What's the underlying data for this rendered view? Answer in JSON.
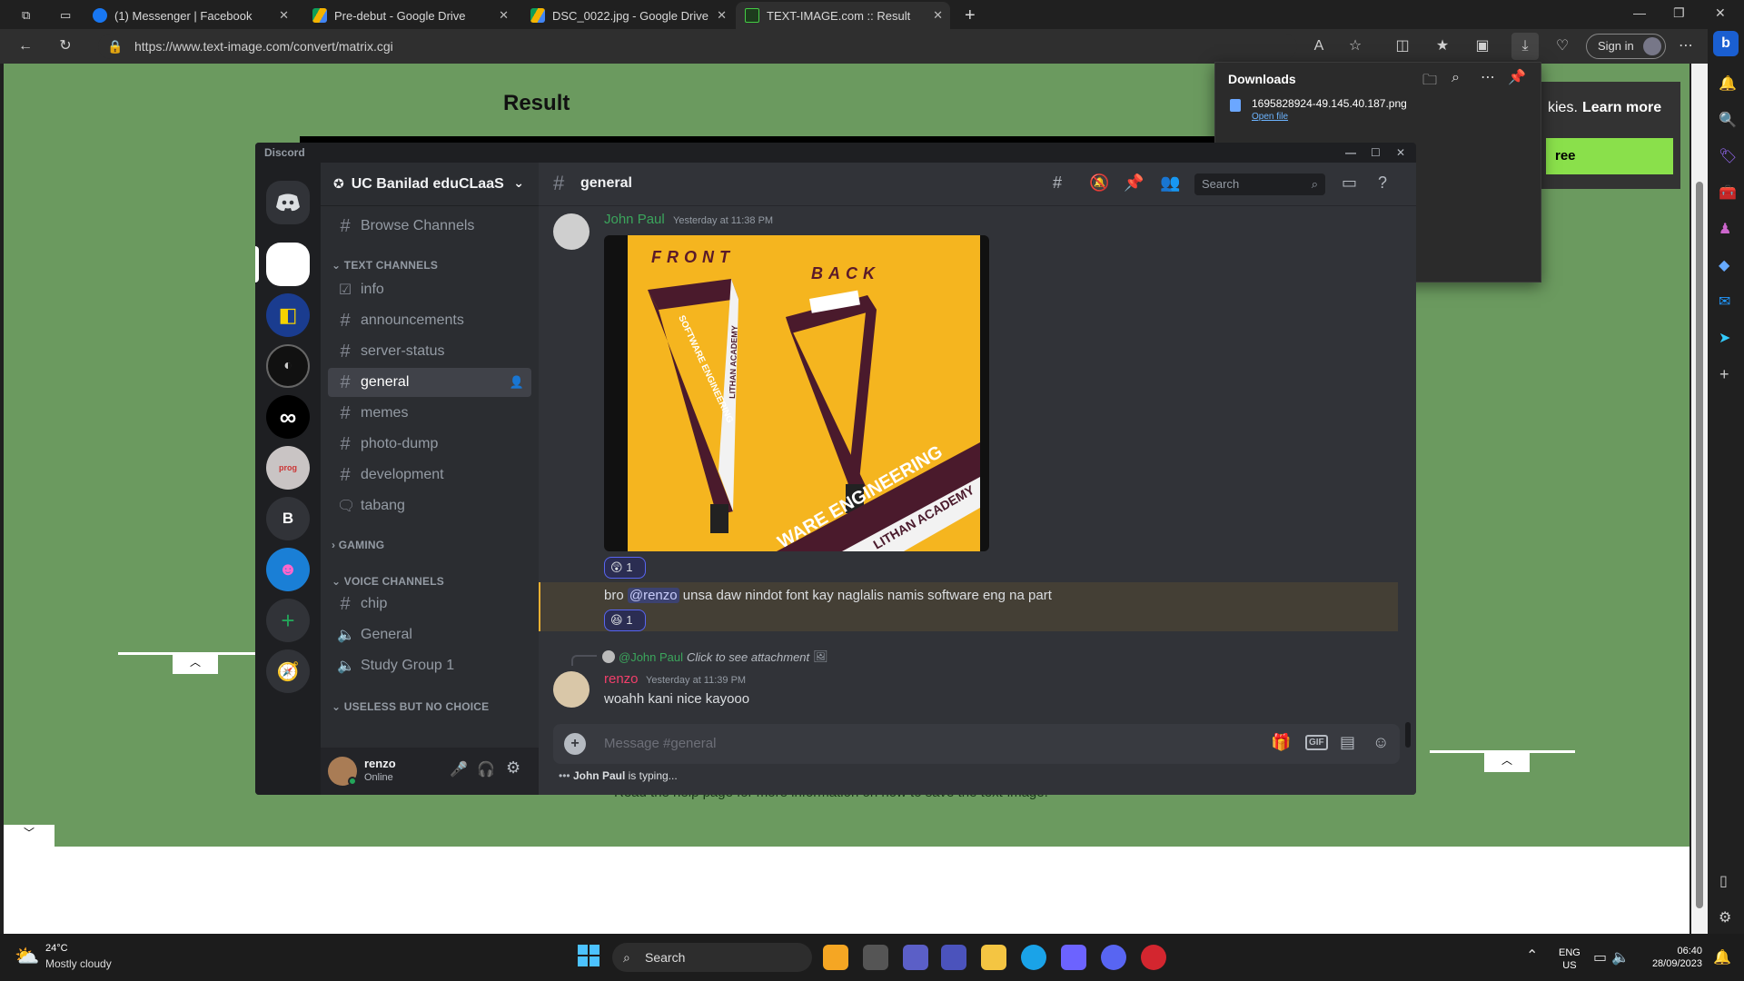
{
  "browser": {
    "tabs": [
      {
        "label": "(1) Messenger | Facebook"
      },
      {
        "label": "Pre-debut - Google Drive"
      },
      {
        "label": "DSC_0022.jpg - Google Drive"
      },
      {
        "label": "TEXT-IMAGE.com :: Result"
      }
    ],
    "url": "https://www.text-image.com/convert/matrix.cgi",
    "sign_in": "Sign in"
  },
  "page": {
    "heading": "Result",
    "cookies_text": "kies.",
    "learn_more": "Learn more",
    "green_button": "ree",
    "footer_text": "Read the help page for more information on how to save the text-image."
  },
  "downloads": {
    "title": "Downloads",
    "file_name": "1695828924-49.145.40.187.png",
    "open_file": "Open file"
  },
  "discord": {
    "app_title": "Discord",
    "server_name": "UC Banilad eduCLaaS",
    "browse_channels": "Browse Channels",
    "categories": {
      "text": "TEXT CHANNELS",
      "gaming": "GAMING",
      "voice": "VOICE CHANNELS",
      "useless": "USELESS BUT NO CHOICE"
    },
    "text_channels": [
      "info",
      "announcements",
      "server-status",
      "general",
      "memes",
      "photo-dump",
      "development",
      "tabang"
    ],
    "voice_channels": [
      "chip",
      "General",
      "Study Group 1"
    ],
    "user": {
      "name": "renzo",
      "status": "Online"
    },
    "channel_header": "general",
    "search_placeholder": "Search",
    "messages": [
      {
        "author": "John Paul",
        "time": "Yesterday at 11:38 PM",
        "reaction_count": "1",
        "image_labels": {
          "front": "FRONT",
          "back": "BACK",
          "lanyard1": "SOFTWARE ENGINEERING",
          "lanyard2": "LITHAN ACADEMY",
          "banner1": "WARE ENGINEERING",
          "banner2": "LITHAN ACADEMY"
        }
      },
      {
        "text_prefix": "bro",
        "mention": "@renzo",
        "text_suffix": "unsa daw nindot font kay naglalis namis software eng na part",
        "reaction_count": "1"
      },
      {
        "reply_to": "@John Paul",
        "reply_text": "Click to see attachment",
        "author": "renzo",
        "time": "Yesterday at 11:39 PM",
        "text": "woahh kani nice kayooo"
      }
    ],
    "composer_placeholder": "Message #general",
    "typing": {
      "user": "John Paul",
      "text": "is typing..."
    },
    "guild_letter": "B"
  },
  "taskbar": {
    "weather_temp": "24°C",
    "weather_desc": "Mostly cloudy",
    "search": "Search",
    "lang1": "ENG",
    "lang2": "US",
    "time": "06:40",
    "date": "28/09/2023"
  },
  "colors": {
    "discord_bg": "#313338",
    "sidebar": "#2b2d31",
    "guild_bar": "#1e1f22",
    "page_green": "#6b9a5f",
    "author_green": "#3ba55c",
    "renzo_pink": "#f23f6b",
    "lanyard_yellow": "#f5b51f",
    "lanyard_maroon": "#4a1a2c"
  }
}
